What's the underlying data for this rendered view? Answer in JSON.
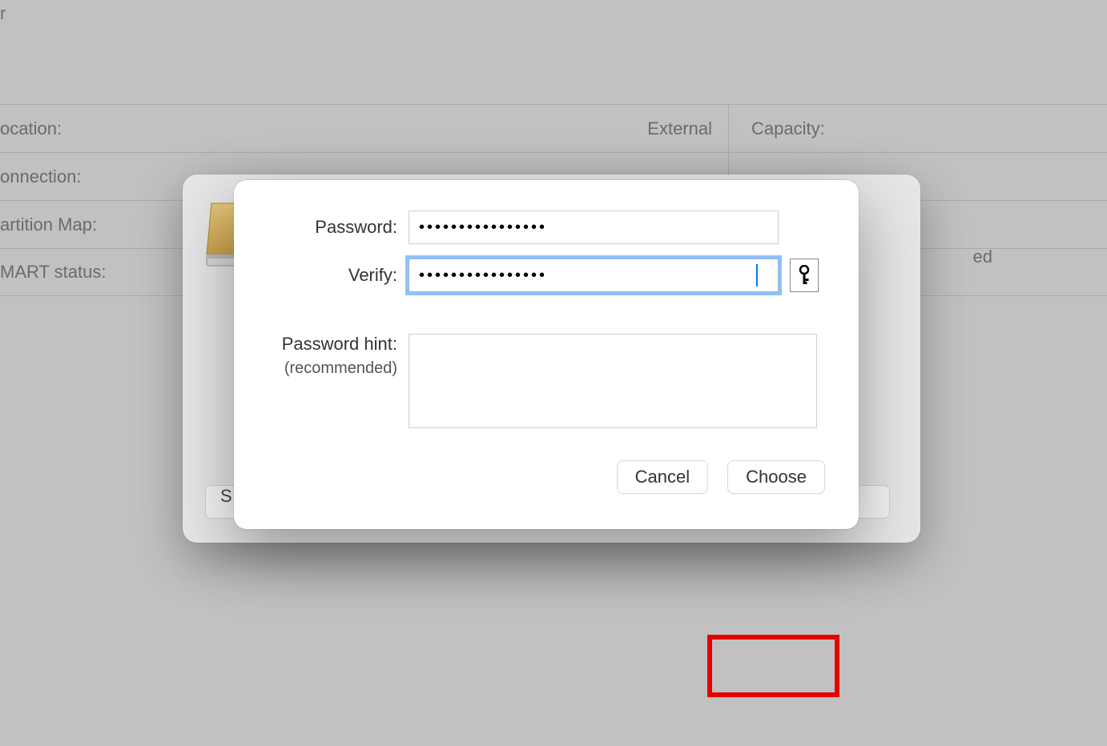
{
  "bgTopChar": "r",
  "infoRows": [
    {
      "labelLeft": "ocation:",
      "valueLeft": "External",
      "labelRight": "Capacity:"
    },
    {
      "labelLeft": "onnection:",
      "valueLeft": "",
      "labelRight": ""
    },
    {
      "labelLeft": "artition Map:",
      "valueLeft": "",
      "labelRight": ""
    },
    {
      "labelLeft": "MART status:",
      "valueLeft": "",
      "labelRight": ""
    }
  ],
  "parentDialog": {
    "bottomBtnText": "S",
    "bottomBtn2Text": "",
    "edText": "ed"
  },
  "dialog": {
    "passwordLabel": "Password:",
    "passwordValue": "••••••••••••••••",
    "verifyLabel": "Verify:",
    "verifyValue": "••••••••••••••••",
    "hintLabel": "Password hint:",
    "hintSubLabel": "(recommended)",
    "hintValue": "",
    "cancelLabel": "Cancel",
    "chooseLabel": "Choose"
  }
}
